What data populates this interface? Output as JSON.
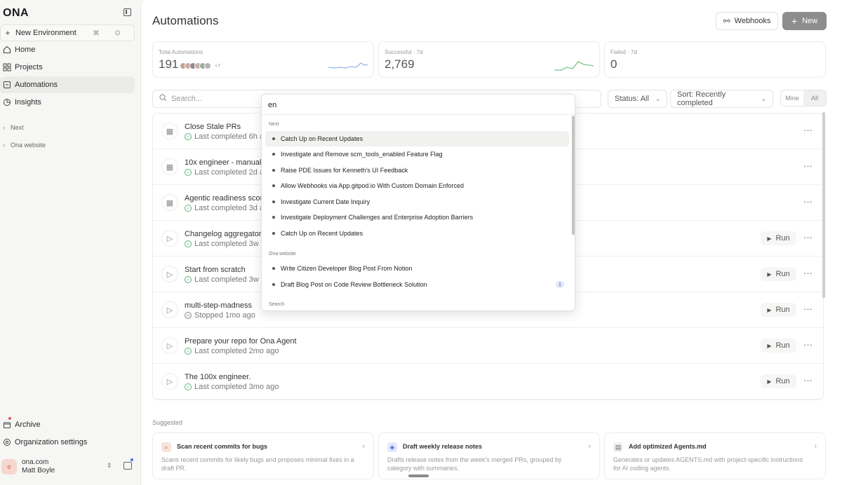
{
  "sidebar": {
    "logo": "ONA",
    "new_environment": {
      "label": "New Environment",
      "shortcut": "⌘ O"
    },
    "nav": [
      {
        "label": "Home",
        "icon": "home-icon"
      },
      {
        "label": "Projects",
        "icon": "grid-icon"
      },
      {
        "label": "Automations",
        "icon": "automation-icon",
        "active": true
      },
      {
        "label": "Insights",
        "icon": "chart-pie-icon"
      }
    ],
    "sections": [
      "Next",
      "Ona website"
    ],
    "archive": "Archive",
    "org_settings": "Organization settings",
    "user": {
      "org": "ona.com",
      "name": "Matt Boyle",
      "initial": "o"
    }
  },
  "header": {
    "title": "Automations",
    "webhooks_label": "Webhooks",
    "new_label": "New"
  },
  "stats": {
    "total": {
      "label": "Total Automations",
      "value": "191",
      "more": "+7"
    },
    "successful": {
      "label": "Successful · 7d",
      "value": "2,769"
    },
    "failed": {
      "label": "Failed · 7d",
      "value": "0"
    }
  },
  "filters": {
    "search_placeholder": "Search...",
    "status_label": "Status: All",
    "sort_label": "Sort: Recently completed",
    "mine": "Mine",
    "all": "All"
  },
  "automations": [
    {
      "title": "Close Stale PRs",
      "status": "Last completed 6h ago",
      "icon": "calendar-clock-icon",
      "state": "done",
      "run": false
    },
    {
      "title": "10x engineer - manual ver",
      "status": "Last completed 2d ago",
      "icon": "calendar-clock-icon",
      "state": "done",
      "run": false
    },
    {
      "title": "Agentic readiness scorer",
      "status": "Last completed 3d ago",
      "icon": "calendar-clock-icon",
      "state": "done",
      "run": false
    },
    {
      "title": "Changelog aggregator",
      "status": "Last completed 3w ago",
      "icon": "play-circle-icon",
      "state": "done",
      "run": true
    },
    {
      "title": "Start from scratch",
      "status": "Last completed 3w ago",
      "icon": "play-circle-icon",
      "state": "done",
      "run": true
    },
    {
      "title": "multi-step-madness",
      "status": "Stopped 1mo ago",
      "icon": "play-circle-icon",
      "state": "stopped",
      "run": true
    },
    {
      "title": "Prepare your repo for Ona Agent",
      "status": "Last completed 2mo ago",
      "icon": "play-circle-icon",
      "state": "done",
      "run": true
    },
    {
      "title": "The 100x engineer.",
      "status": "Last completed 3mo ago",
      "icon": "play-circle-icon",
      "state": "done",
      "run": true
    }
  ],
  "run_label": "Run",
  "suggested": {
    "label": "Suggested",
    "cards": [
      {
        "title": "Scan recent commits for bugs",
        "desc": "Scans recent commits for likely bugs and proposes minimal fixes in a draft PR.",
        "icon": "search-icon",
        "color": "#f7e3da"
      },
      {
        "title": "Draft weekly release notes",
        "desc": "Drafts release notes from the week's merged PRs, grouped by category with summaries.",
        "icon": "megaphone-icon",
        "color": "#e3e8fb"
      },
      {
        "title": "Add optimized Agents.md",
        "desc": "Generates or updates AGENTS.md with project-specific instructions for AI coding agents.",
        "icon": "document-icon",
        "color": "#f0f0ee"
      }
    ]
  },
  "popup": {
    "query": "en",
    "groups": [
      {
        "label": "Next",
        "items": [
          {
            "label": "Catch Up on Recent Updates",
            "highlighted": true
          },
          {
            "label": "Investigate and Remove scm_tools_enabled Feature Flag"
          },
          {
            "label": "Raise PDE Issues for Kenneth's UI Feedback"
          },
          {
            "label": "Allow Webhooks via App.gitpod.io With Custom Domain Enforced"
          },
          {
            "label": "Investigate Current Date Inquiry"
          },
          {
            "label": "Investigate Deployment Challenges and Enterprise Adoption Barriers"
          },
          {
            "label": "Catch Up on Recent Updates"
          }
        ]
      },
      {
        "label": "Ona website",
        "items": [
          {
            "label": "Write Citizen Developer Blog Post From Notion"
          },
          {
            "label": "Draft Blog Post on Code Review Bottleneck Solution",
            "badge": "1"
          }
        ]
      }
    ],
    "search_section": "Search"
  },
  "colors": {
    "success": "#5bb57a",
    "accent": "#4a6ee0",
    "spark_blue": "#9ab8e8",
    "spark_green": "#7cc48e"
  }
}
